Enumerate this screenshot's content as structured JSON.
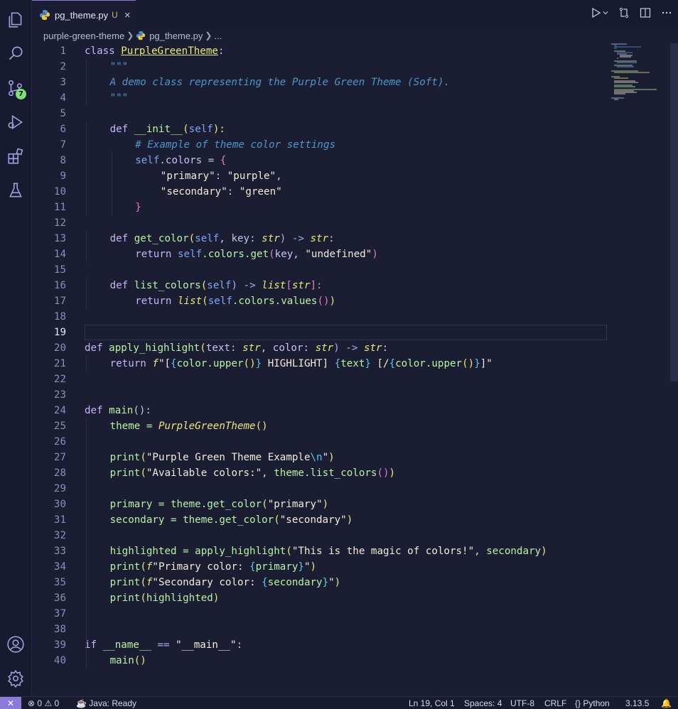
{
  "tab": {
    "filename": "pg_theme.py",
    "status": "U",
    "close": "×"
  },
  "breadcrumb": {
    "folder": "purple-green-theme",
    "file": "pg_theme.py",
    "more": "..."
  },
  "activity": {
    "scm_badge": "7"
  },
  "status": {
    "errors": "0",
    "warnings": "0",
    "java": "Java: Ready",
    "position": "Ln 19, Col 1",
    "spaces": "Spaces: 4",
    "encoding": "UTF-8",
    "eol": "CRLF",
    "language": "Python",
    "version": "3.13.5"
  },
  "code_lines": [
    [
      "class ",
      "PurpleGreenTheme",
      ":"
    ],
    [
      "\"\"\""
    ],
    [
      "A demo class representing the Purple Green Theme (Soft)."
    ],
    [
      "\"\"\""
    ],
    [],
    [
      "def ",
      "__init__",
      "(",
      "self",
      "):"
    ],
    [
      "# Example of theme color settings"
    ],
    [
      "self",
      ".colors = ",
      "{"
    ],
    [
      "\"primary\"",
      ": ",
      "\"purple\"",
      ","
    ],
    [
      "\"secondary\"",
      ": ",
      "\"green\""
    ],
    [
      "}"
    ],
    [],
    [
      "def ",
      "get_color",
      "(",
      "self",
      ", key: ",
      "str",
      ") -> ",
      "str",
      ":"
    ],
    [
      "return ",
      "self",
      ".colors.get",
      "(",
      "key, ",
      "\"undefined\"",
      ")"
    ],
    [],
    [
      "def ",
      "list_colors",
      "(",
      "self",
      ") -> ",
      "list",
      "[",
      "str",
      "]:"
    ],
    [
      "return ",
      "list",
      "(",
      "self",
      ".colors.values",
      "()",
      ")"
    ],
    [],
    [],
    [
      "def ",
      "apply_highlight",
      "(",
      "text: ",
      "str",
      ", color: ",
      "str",
      ") -> ",
      "str",
      ":"
    ],
    [
      "return ",
      "f",
      "\"[",
      "{",
      "color.upper",
      "()",
      "}",
      " HIGHLIGHT] ",
      "{",
      "text",
      "}",
      " [/",
      "{",
      "color.upper",
      "()",
      "}",
      "]\""
    ],
    [],
    [],
    [
      "def ",
      "main",
      "():"
    ],
    [
      "theme = ",
      "PurpleGreenTheme",
      "()"
    ],
    [],
    [
      "print",
      "(",
      "\"Purple Green Theme Example",
      "\\n",
      "\"",
      ")"
    ],
    [
      "print",
      "(",
      "\"Available colors:\"",
      ", theme.list_colors",
      "()",
      ")"
    ],
    [],
    [
      "primary = theme.get_color",
      "(",
      "\"primary\"",
      ")"
    ],
    [
      "secondary = theme.get_color",
      "(",
      "\"secondary\"",
      ")"
    ],
    [],
    [
      "highlighted = apply_highlight",
      "(",
      "\"This is the magic of colors!\"",
      ", secondary",
      ")"
    ],
    [
      "print",
      "(",
      "f",
      "\"Primary color: ",
      "{",
      "primary",
      "}",
      "\"",
      ")"
    ],
    [
      "print",
      "(",
      "f",
      "\"Secondary color: ",
      "{",
      "secondary",
      "}",
      "\"",
      ")"
    ],
    [
      "print",
      "(",
      "highlighted",
      ")"
    ],
    [],
    [],
    [
      "if ",
      "__name__",
      " == ",
      "\"__main__\"",
      ":"
    ],
    [
      "main",
      "()"
    ]
  ]
}
